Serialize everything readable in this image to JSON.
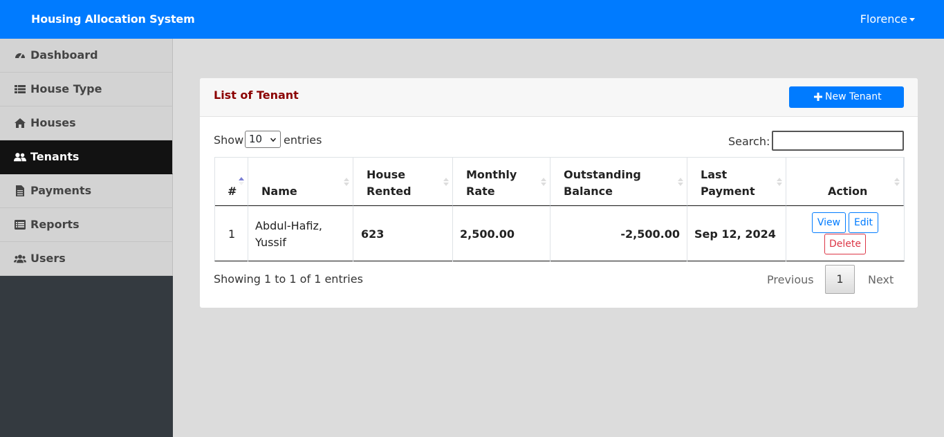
{
  "header": {
    "brand": "Housing Allocation System",
    "user": "Florence"
  },
  "sidebar": {
    "items": [
      {
        "label": "Dashboard",
        "icon": "tachometer-icon",
        "active": false
      },
      {
        "label": "House Type",
        "icon": "list-grid-icon",
        "active": false
      },
      {
        "label": "Houses",
        "icon": "home-icon",
        "active": false
      },
      {
        "label": "Tenants",
        "icon": "user-friends-icon",
        "active": true
      },
      {
        "label": "Payments",
        "icon": "file-invoice-icon",
        "active": false
      },
      {
        "label": "Reports",
        "icon": "list-alt-icon",
        "active": false
      },
      {
        "label": "Users",
        "icon": "users-icon",
        "active": false
      }
    ]
  },
  "card": {
    "title": "List of Tenant",
    "new_button": "New Tenant",
    "show_label": "Show",
    "entries_value": "10",
    "entries_label": "entries",
    "search_label": "Search:",
    "search_value": "",
    "columns": [
      "#",
      "Name",
      "House\nRented",
      "Monthly\nRate",
      "Outstanding\nBalance",
      "Last\nPayment",
      "Action"
    ],
    "rows": [
      {
        "num": "1",
        "name": "Abdul-Hafiz,\nYussif",
        "house": "623",
        "rate": "2,500.00",
        "balance": "-2,500.00",
        "last_payment": "Sep 12, 2024",
        "actions": {
          "view": "View",
          "edit": "Edit",
          "delete": "Delete"
        }
      }
    ],
    "info": "Showing 1 to 1 of 1 entries",
    "pagination": {
      "previous": "Previous",
      "page": "1",
      "next": "Next"
    }
  },
  "colors": {
    "primary": "#007bff",
    "title": "#8b0000",
    "danger": "#dc3545",
    "sidebar_active": "#121212"
  }
}
